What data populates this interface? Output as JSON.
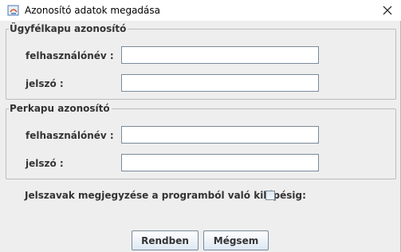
{
  "window": {
    "title": "Azonosító adatok megadása",
    "app_icon": "java-app-icon",
    "close_icon": "close-icon"
  },
  "groups": [
    {
      "legend": "Ügyfélkapu azonosító",
      "username_label": "felhasználónév :",
      "username_value": "",
      "password_label": "jelszó :",
      "password_value": ""
    },
    {
      "legend": "Perkapu azonosító",
      "username_label": "felhasználónév :",
      "username_value": "",
      "password_label": "jelszó :",
      "password_value": ""
    }
  ],
  "remember": {
    "label": "Jelszavak megjegyzése a programból való kilépésig:",
    "checked": false
  },
  "buttons": {
    "ok_label": "Rendben",
    "cancel_label": "Mégsem"
  },
  "colors": {
    "window_background": "#eeeeee",
    "border": "#7a8a99",
    "text": "#333333"
  }
}
